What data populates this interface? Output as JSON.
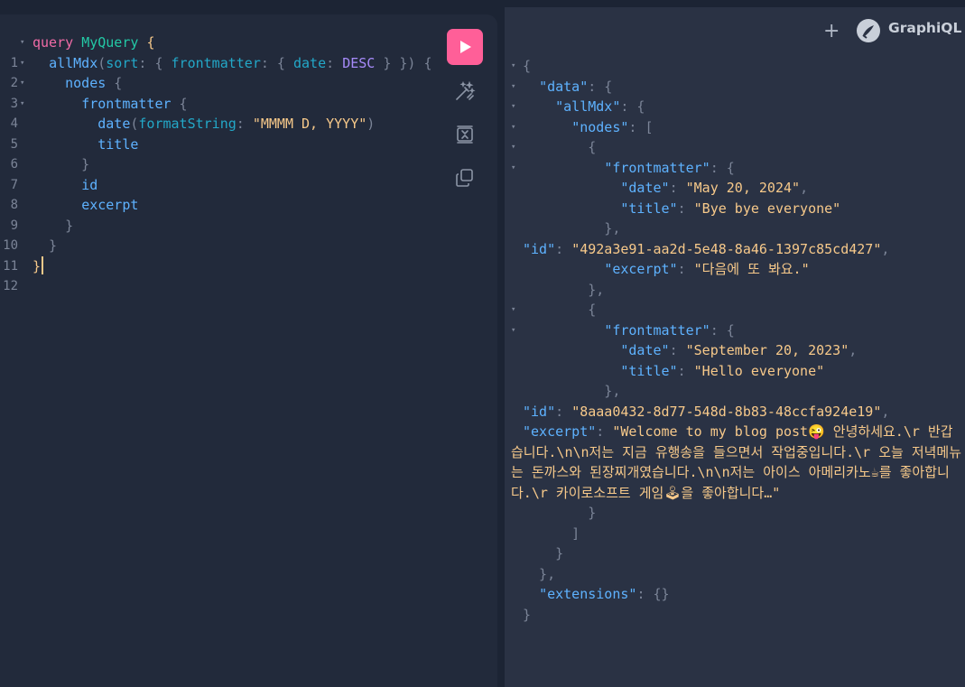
{
  "app": {
    "brand": "GraphiQL",
    "new_tab": "+"
  },
  "editor": {
    "lines": [
      {
        "n": "1",
        "fold": "▾"
      },
      {
        "n": "2",
        "fold": "▾"
      },
      {
        "n": "3",
        "fold": "▾"
      },
      {
        "n": "4",
        "fold": "▾"
      },
      {
        "n": "5",
        "fold": ""
      },
      {
        "n": "6",
        "fold": ""
      },
      {
        "n": "7",
        "fold": ""
      },
      {
        "n": "8",
        "fold": ""
      },
      {
        "n": "9",
        "fold": ""
      },
      {
        "n": "10",
        "fold": ""
      },
      {
        "n": "11",
        "fold": ""
      },
      {
        "n": "12",
        "fold": ""
      }
    ],
    "keyword": "query",
    "op_name": "MyQuery",
    "field_root": "allMdx",
    "arg_sort": "sort",
    "arg_frontmatter": "frontmatter",
    "arg_date": "date",
    "enum_desc": "DESC",
    "field_nodes": "nodes",
    "field_frontmatter": "frontmatter",
    "field_date": "date",
    "arg_format": "formatString",
    "format_value": "\"MMMM D, YYYY\"",
    "field_title": "title",
    "field_id": "id",
    "field_excerpt": "excerpt"
  },
  "result": {
    "k_data": "\"data\"",
    "k_allMdx": "\"allMdx\"",
    "k_nodes": "\"nodes\"",
    "k_frontmatter": "\"frontmatter\"",
    "k_date": "\"date\"",
    "k_title": "\"title\"",
    "k_id": "\"id\"",
    "k_excerpt": "\"excerpt\"",
    "k_extensions": "\"extensions\"",
    "node1": {
      "date": "\"May 20, 2024\"",
      "title": "\"Bye bye everyone\"",
      "id": "\"492a3e91-aa2d-5e48-8a46-1397c85cd427\"",
      "excerpt": "\"다음에 또 봐요.\""
    },
    "node2": {
      "date": "\"September 20, 2023\"",
      "title": "\"Hello everyone\"",
      "id": "\"8aaa0432-8d77-548d-8b83-48ccfa924e19\"",
      "excerpt": "\"Welcome to my blog post😜 안녕하세요.\\r 반갑습니다.\\n\\n저는 지금 유행송을 들으면서 작업중입니다.\\r 오늘 저녁메뉴는 돈까스와 된장찌개였습니다.\\n\\n저는 아이스 아메리카노☕를 좋아합니다.\\r 카이로소프트 게임🕹을 좋아합니다…\""
    },
    "extensions_value": "{}"
  },
  "colors": {
    "accent": "#ff5f98",
    "string": "#f7c98a",
    "key": "#5eb2ff"
  },
  "icons": [
    "play-icon",
    "prettify-icon",
    "merge-icon",
    "copy-icon",
    "plus-icon",
    "graphiql-logo-icon"
  ]
}
